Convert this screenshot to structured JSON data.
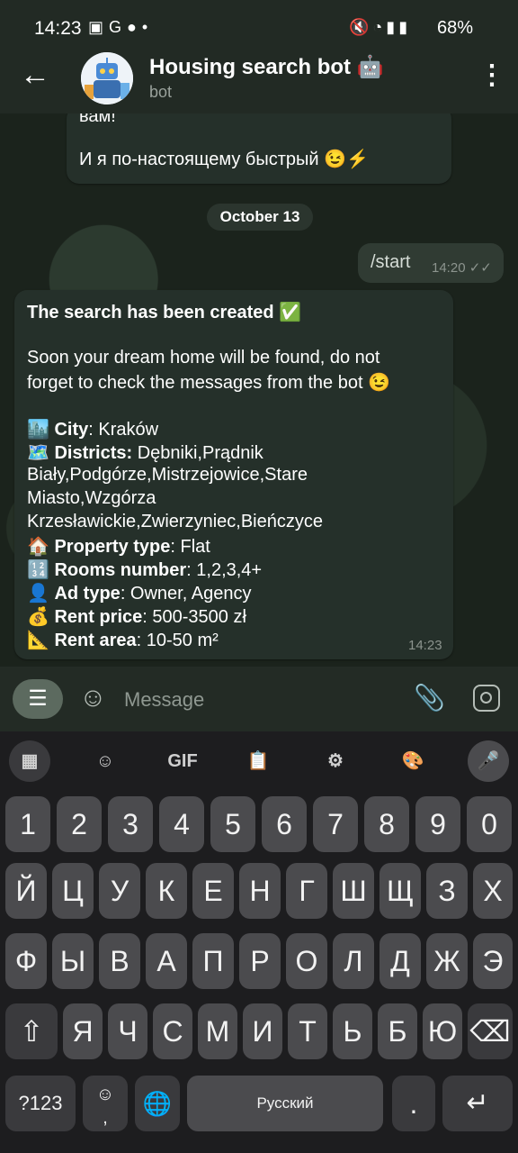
{
  "status_bar": {
    "time": "14:23",
    "left_icons": [
      "gallery-icon",
      "google-icon",
      "chat-icon",
      "dot"
    ],
    "right_icons": [
      "mute-icon",
      "wifi-icon",
      "signal-icon",
      "signal-icon"
    ],
    "battery": "68%"
  },
  "header": {
    "title": "Housing search bot 🤖",
    "subtitle": "bot"
  },
  "chat": {
    "prev_message": {
      "line1": "вам!",
      "line2": "И я по-настоящему быстрый 😉⚡"
    },
    "date_divider": "October 13",
    "outgoing": {
      "text": "/start",
      "time": "14:20"
    },
    "bot_message": {
      "heading": "The search has been created ✅",
      "intro_line1": "Soon your dream home will be found, do not",
      "intro_line2": "forget to check the messages from the bot 😉",
      "city_label": "City",
      "city_value": ": Kraków",
      "districts_label": "Districts:",
      "districts_line1": " Dębniki,Prądnik",
      "districts_line2": "Biały,Podgórze,Mistrzejowice,Stare",
      "districts_line3": "Miasto,Wzgórza",
      "districts_line4": "Krzesławickie,Zwierzyniec,Bieńczyce",
      "property_label": "Property type",
      "property_value": ": Flat",
      "rooms_label": "Rooms number",
      "rooms_value": ": 1,2,3,4+",
      "adtype_label": "Ad type",
      "adtype_value": ": Owner, Agency",
      "rent_label": "Rent price",
      "rent_value": ": 500-3500 zł",
      "area_label": "Rent area",
      "area_value": ": 10-50 m²",
      "time": "14:23"
    }
  },
  "input_bar": {
    "placeholder": "Message"
  },
  "keyboard": {
    "toolbar": [
      "apps-icon",
      "sticker-icon",
      "GIF",
      "clipboard-icon",
      "settings-icon",
      "palette-icon",
      "mic-icon"
    ],
    "gif_label": "GIF",
    "row_digits": [
      "1",
      "2",
      "3",
      "4",
      "5",
      "6",
      "7",
      "8",
      "9",
      "0"
    ],
    "row1": [
      "Й",
      "Ц",
      "У",
      "К",
      "Е",
      "Н",
      "Г",
      "Ш",
      "Щ",
      "З",
      "Х"
    ],
    "row2": [
      "Ф",
      "Ы",
      "В",
      "А",
      "П",
      "Р",
      "О",
      "Л",
      "Д",
      "Ж",
      "Э"
    ],
    "row3": [
      "Я",
      "Ч",
      "С",
      "М",
      "И",
      "Т",
      "Ь",
      "Б",
      "Ю"
    ],
    "sym_label": "?123",
    "comma": ",",
    "space_label": "Русский",
    "period": "."
  }
}
